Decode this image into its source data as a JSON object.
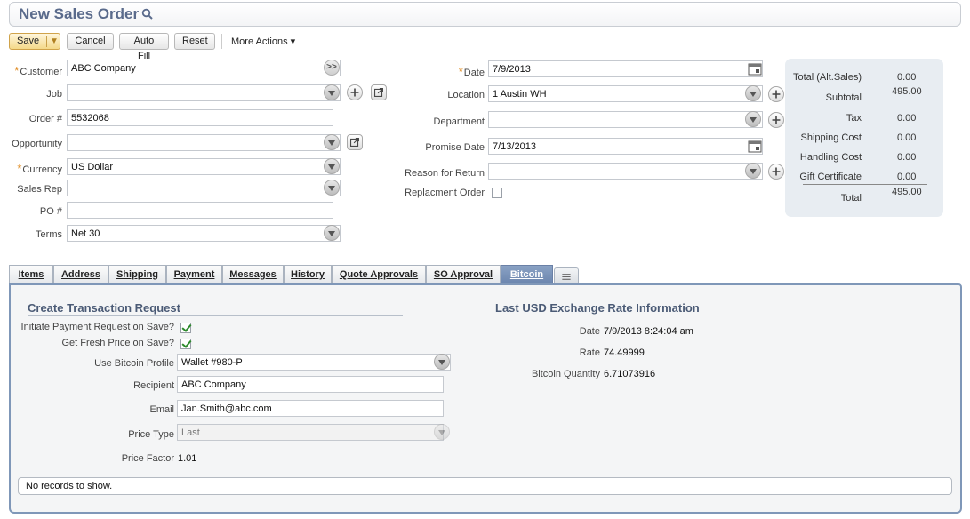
{
  "header": {
    "title": "New Sales Order"
  },
  "toolbar": {
    "save_label": "Save",
    "cancel_label": "Cancel",
    "autofill_label": "Auto Fill",
    "reset_label": "Reset",
    "more_actions_label": "More Actions ▾"
  },
  "form_left": {
    "customer": {
      "label": "Customer",
      "value": "ABC Company"
    },
    "job": {
      "label": "Job",
      "value": ""
    },
    "order_num": {
      "label": "Order #",
      "value": "5532068"
    },
    "opportunity": {
      "label": "Opportunity",
      "value": ""
    },
    "currency": {
      "label": "Currency",
      "value": "US Dollar"
    },
    "sales_rep": {
      "label": "Sales Rep",
      "value": ""
    },
    "po_num": {
      "label": "PO #",
      "value": ""
    },
    "terms": {
      "label": "Terms",
      "value": "Net 30"
    }
  },
  "form_mid": {
    "date": {
      "label": "Date",
      "value": "7/9/2013"
    },
    "location": {
      "label": "Location",
      "value": "1 Austin WH"
    },
    "department": {
      "label": "Department",
      "value": ""
    },
    "promise_date": {
      "label": "Promise Date",
      "value": "7/13/2013"
    },
    "reason_return": {
      "label": "Reason for Return",
      "value": ""
    },
    "replacement_order": {
      "label": "Replacment Order",
      "checked": false
    }
  },
  "totals": {
    "alt_sales": {
      "label": "Total (Alt.Sales)",
      "value": "0.00"
    },
    "subtotal": {
      "label": "Subtotal",
      "value": "495.00"
    },
    "tax": {
      "label": "Tax",
      "value": "0.00"
    },
    "shipping": {
      "label": "Shipping Cost",
      "value": "0.00"
    },
    "handling": {
      "label": "Handling Cost",
      "value": "0.00"
    },
    "gift": {
      "label": "Gift Certificate",
      "value": "0.00"
    },
    "total": {
      "label": "Total",
      "value": "495.00"
    }
  },
  "tabs": [
    {
      "label": "Items"
    },
    {
      "label": "Address"
    },
    {
      "label": "Shipping"
    },
    {
      "label": "Payment"
    },
    {
      "label": "Messages"
    },
    {
      "label": "History"
    },
    {
      "label": "Quote Approvals"
    },
    {
      "label": "SO Approval"
    },
    {
      "label": "Bitcoin",
      "active": true
    }
  ],
  "bitcoin": {
    "create_title": "Create Transaction Request",
    "initiate": {
      "label": "Initiate Payment Request on Save?",
      "checked": true
    },
    "fresh_price": {
      "label": "Get Fresh Price on Save?",
      "checked": true
    },
    "profile": {
      "label": "Use Bitcoin Profile",
      "value": "Wallet #980-P"
    },
    "recipient": {
      "label": "Recipient",
      "value": "ABC Company"
    },
    "email": {
      "label": "Email",
      "value": "Jan.Smith@abc.com"
    },
    "price_type": {
      "label": "Price Type",
      "value": "Last"
    },
    "price_factor": {
      "label": "Price Factor",
      "value": "1.01"
    },
    "rate_title": "Last USD Exchange Rate Information",
    "rate_date": {
      "label": "Date",
      "value": "7/9/2013 8:24:04 am"
    },
    "rate": {
      "label": "Rate",
      "value": "74.49999"
    },
    "quantity": {
      "label": "Bitcoin Quantity",
      "value": "6.71073916"
    },
    "no_records": "No records to show."
  },
  "colors": {
    "accent": "#5a6b8c",
    "tab_active": "#7891b7",
    "required": "#e08a1e"
  }
}
